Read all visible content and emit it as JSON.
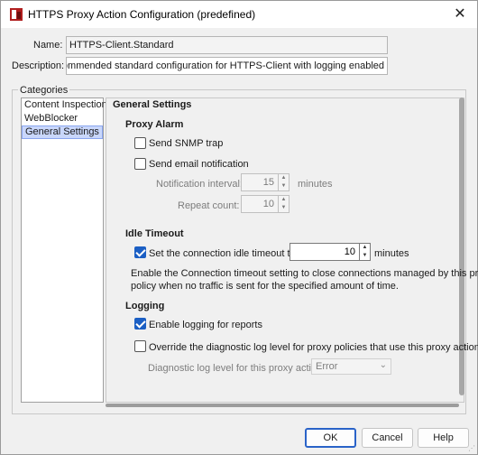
{
  "window": {
    "title": "HTTPS Proxy Action Configuration (predefined)",
    "close_glyph": "✕"
  },
  "form": {
    "name_label": "Name:",
    "name_value": "HTTPS-Client.Standard",
    "description_label": "Description:",
    "description_value": "Guard recommended standard configuration for HTTPS-Client with logging enabled"
  },
  "categories": {
    "legend": "Categories",
    "items": [
      {
        "label": "Content Inspection",
        "selected": false
      },
      {
        "label": "WebBlocker",
        "selected": false
      },
      {
        "label": "General Settings",
        "selected": true
      }
    ]
  },
  "general": {
    "title": "General Settings",
    "proxy_alarm": {
      "heading": "Proxy Alarm",
      "snmp_label": "Send SNMP trap",
      "snmp_checked": false,
      "email_label": "Send email notification",
      "email_checked": false,
      "interval_label": "Notification interval:",
      "interval_value": "15",
      "interval_unit": "minutes",
      "repeat_label": "Repeat count:",
      "repeat_value": "10"
    },
    "idle_timeout": {
      "heading": "Idle Timeout",
      "set_label": "Set the connection idle timeout to",
      "set_checked": true,
      "value": "10",
      "unit": "minutes",
      "help_line1": "Enable the Connection timeout setting to close connections managed by this proxy",
      "help_line2": "policy when no traffic is sent for the specified amount of time."
    },
    "logging": {
      "heading": "Logging",
      "enable_label": "Enable logging for reports",
      "enable_checked": true,
      "override_label": "Override the diagnostic log level for proxy policies that use this proxy action",
      "override_checked": false,
      "level_label": "Diagnostic log level for this proxy action",
      "level_value": "Error"
    }
  },
  "buttons": {
    "ok": "OK",
    "cancel": "Cancel",
    "help": "Help"
  },
  "colors": {
    "accent": "#1b5fc4",
    "selection": "#c9d7fb",
    "app_icon": "#b01e1e"
  }
}
